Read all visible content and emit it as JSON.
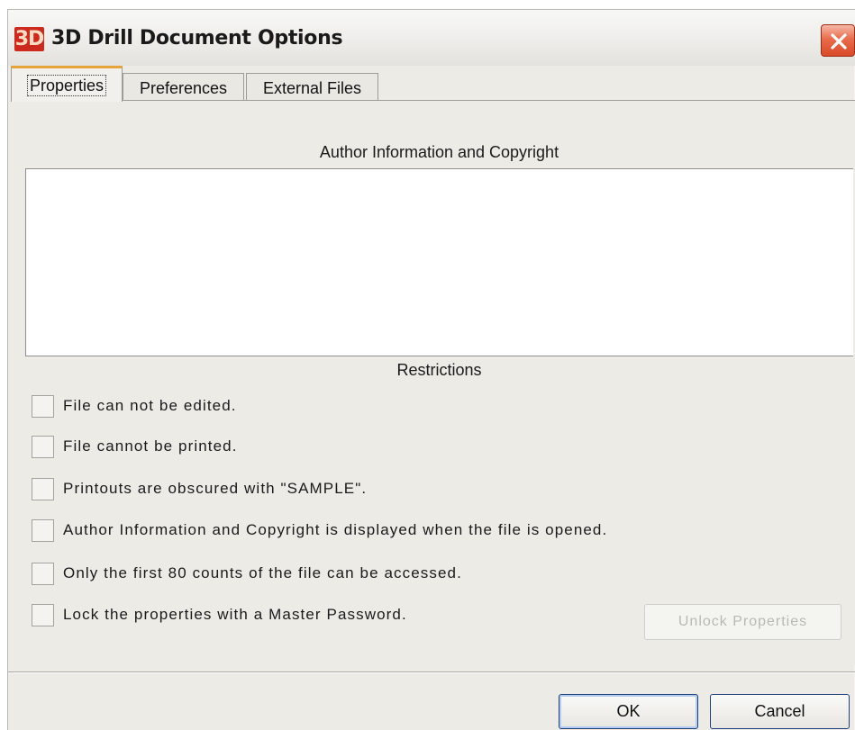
{
  "window": {
    "logo_text": "3D",
    "title": "3D Drill Document Options"
  },
  "tabs": [
    {
      "label": "Properties",
      "active": true
    },
    {
      "label": "Preferences",
      "active": false
    },
    {
      "label": "External Files",
      "active": false
    }
  ],
  "properties": {
    "author_heading": "Author Information and Copyright",
    "author_text": "",
    "restrictions_heading": "Restrictions",
    "restrictions": [
      {
        "label": "File can not be edited.",
        "checked": false
      },
      {
        "label": "File cannot be printed.",
        "checked": false
      },
      {
        "label": "Printouts are obscured with \"SAMPLE\".",
        "checked": false
      },
      {
        "label": "Author Information and Copyright is displayed when the file is opened.",
        "checked": false
      },
      {
        "label": "Only the first 80 counts of the file can be accessed.",
        "checked": false
      },
      {
        "label": "Lock the properties with a Master Password.",
        "checked": false
      }
    ],
    "unlock_button": "Unlock Properties",
    "unlock_enabled": false
  },
  "footer": {
    "ok_label": "OK",
    "cancel_label": "Cancel"
  },
  "colors": {
    "dialog_bg": "#ecebe6",
    "close_button": "#e05a3a",
    "active_tab_accent": "#e7a43a",
    "logo_bg": "#cc2a1e"
  },
  "icons": {
    "close": "close-icon",
    "logo": "app-logo-icon"
  }
}
